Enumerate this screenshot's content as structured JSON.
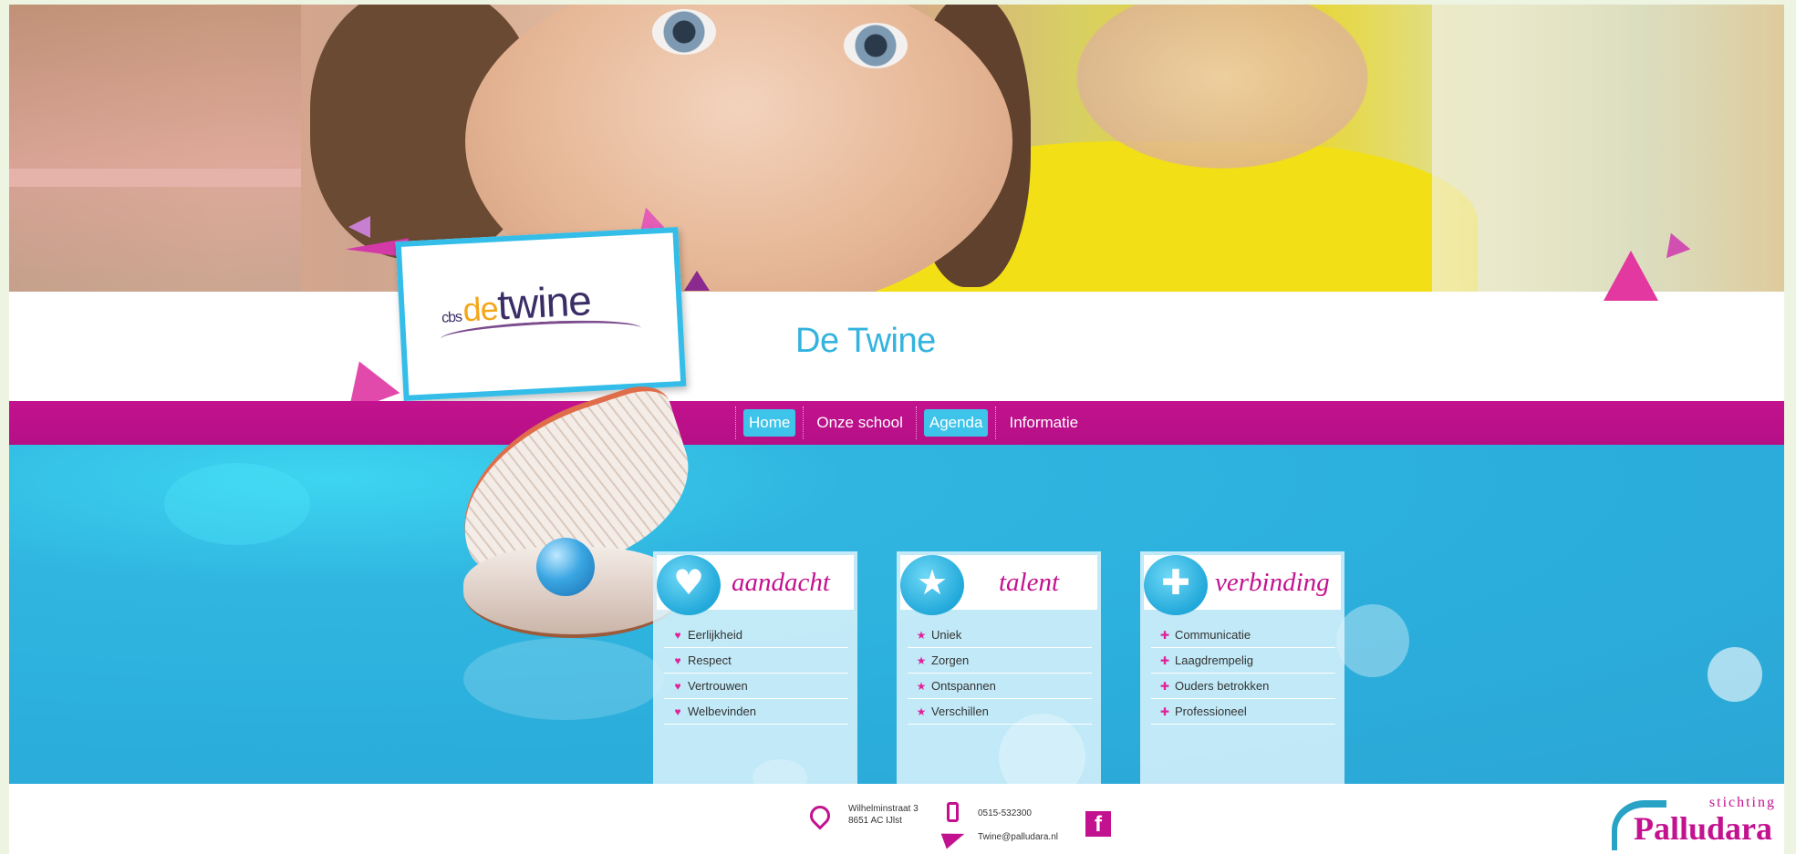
{
  "site": {
    "title": "De Twine",
    "logo": {
      "prefix": "cbs",
      "accent": "de",
      "main": "twine"
    }
  },
  "nav": {
    "items": [
      {
        "label": "Home",
        "active": true
      },
      {
        "label": "Onze school",
        "active": false
      },
      {
        "label": "Agenda",
        "active": true
      },
      {
        "label": "Informatie",
        "active": false
      }
    ]
  },
  "features": [
    {
      "title": "aandacht",
      "icon": "heart-icon",
      "bullet": "♥",
      "items": [
        "Eerlijkheid",
        "Respect",
        "Vertrouwen",
        "Welbevinden"
      ]
    },
    {
      "title": "talent",
      "icon": "star-icon",
      "bullet": "★",
      "items": [
        "Uniek",
        "Zorgen",
        "Ontspannen",
        "Verschillen"
      ]
    },
    {
      "title": "verbinding",
      "icon": "plus-icon",
      "bullet": "✚",
      "items": [
        "Communicatie",
        "Laagdrempelig",
        "Ouders betrokken",
        "Professioneel"
      ]
    }
  ],
  "footer": {
    "address_line1": "Wilhelminstraat 3",
    "address_line2": "8651 AC IJlst",
    "phone": "0515-532300",
    "email": "Twine@palludara.nl",
    "facebook_label": "f",
    "brand_small": "stichting",
    "brand_big": "Palludara"
  },
  "colors": {
    "magenta": "#c3128f",
    "cyan": "#33b3dd",
    "nav_active": "#3ec4ea"
  }
}
